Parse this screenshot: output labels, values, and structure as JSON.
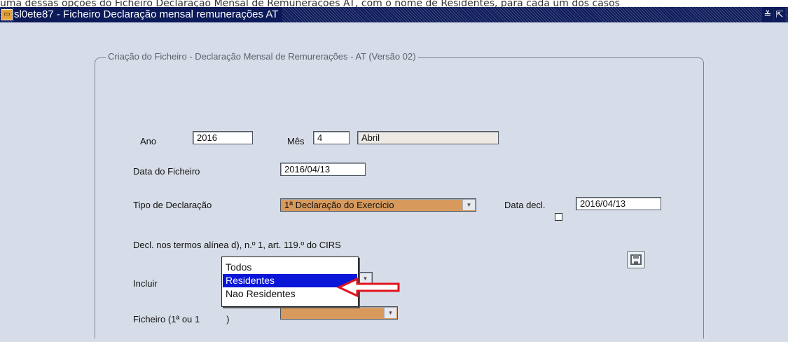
{
  "caption": "uma dessas opções do Ficheiro Declaração Mensal de Remunerações AT, com o nome de Residentes, para cada um dos casos",
  "window": {
    "title": "sl0ete87 - Ficheiro Declaração mensal remunerações AT",
    "minimize_glyph": "≚",
    "maximize_glyph": "⇱"
  },
  "group": {
    "title": "Criação do Ficheiro - Declaração Mensal de Remurerações - AT (Versão 02)"
  },
  "form": {
    "ano_label": "Ano",
    "ano_value": "2016",
    "mes_label": "Mês",
    "mes_value": "4",
    "mes_nome": "Abril",
    "data_ficheiro_label": "Data do Ficheiro",
    "data_ficheiro_value": "2016/04/13",
    "tipo_declaracao_label": "Tipo de Declaração",
    "tipo_declaracao_value": "1ª Declaração do Exercício",
    "data_decl_label": "Data decl.",
    "data_decl_value": "2016/04/13",
    "decl_alinea_label": "Decl. nos termos alínea d), n.º 1, art. 119.º do CIRS",
    "decl_alinea_checked": false,
    "incluir_label": "Incluir",
    "ficheiro_label_visible": "Ficheiro (1ª ou 1",
    "ficheiro_label_tail": ")"
  },
  "incluir_dropdown": {
    "options": [
      "Todos",
      "Residentes",
      "Nao Residentes"
    ],
    "highlighted_index": 1,
    "highlight_color": "#0a16d8"
  },
  "annotation": {
    "arrow_color": "#e0141e"
  },
  "colors": {
    "titlebar": "#0c1a5a",
    "canvas": "#d7dde8",
    "combo_fill": "#d89a5c",
    "readonly_fill": "#ede9e3"
  }
}
